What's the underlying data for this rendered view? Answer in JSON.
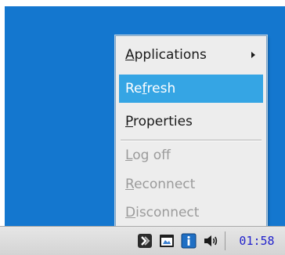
{
  "menu": {
    "applications": {
      "label": "Applications",
      "mnemonic": "A",
      "rest": "pplications",
      "has_submenu": true
    },
    "refresh": {
      "label": "Refresh",
      "pre": "Re",
      "mnemonic": "f",
      "rest": "resh",
      "state": "highlighted"
    },
    "properties": {
      "label": "Properties",
      "mnemonic": "P",
      "rest": "roperties"
    },
    "log_off": {
      "label": "Log off",
      "mnemonic": "L",
      "rest": "og off",
      "state": "disabled"
    },
    "reconnect": {
      "label": "Reconnect",
      "mnemonic": "R",
      "rest": "econnect",
      "state": "disabled"
    },
    "disconnect": {
      "label": "Disconnect",
      "mnemonic": "D",
      "rest": "isconnect",
      "state": "disabled"
    }
  },
  "taskbar": {
    "tray_icons": [
      "session-app-icon",
      "window-icon",
      "info-icon",
      "speaker-volume-icon"
    ],
    "clock": "01:58"
  },
  "colors": {
    "desktop": "#1477cf",
    "menu_background": "#ededed",
    "highlight": "#35a5e4",
    "disabled_text": "#9b9b9b",
    "clock_text": "#2222cc"
  }
}
